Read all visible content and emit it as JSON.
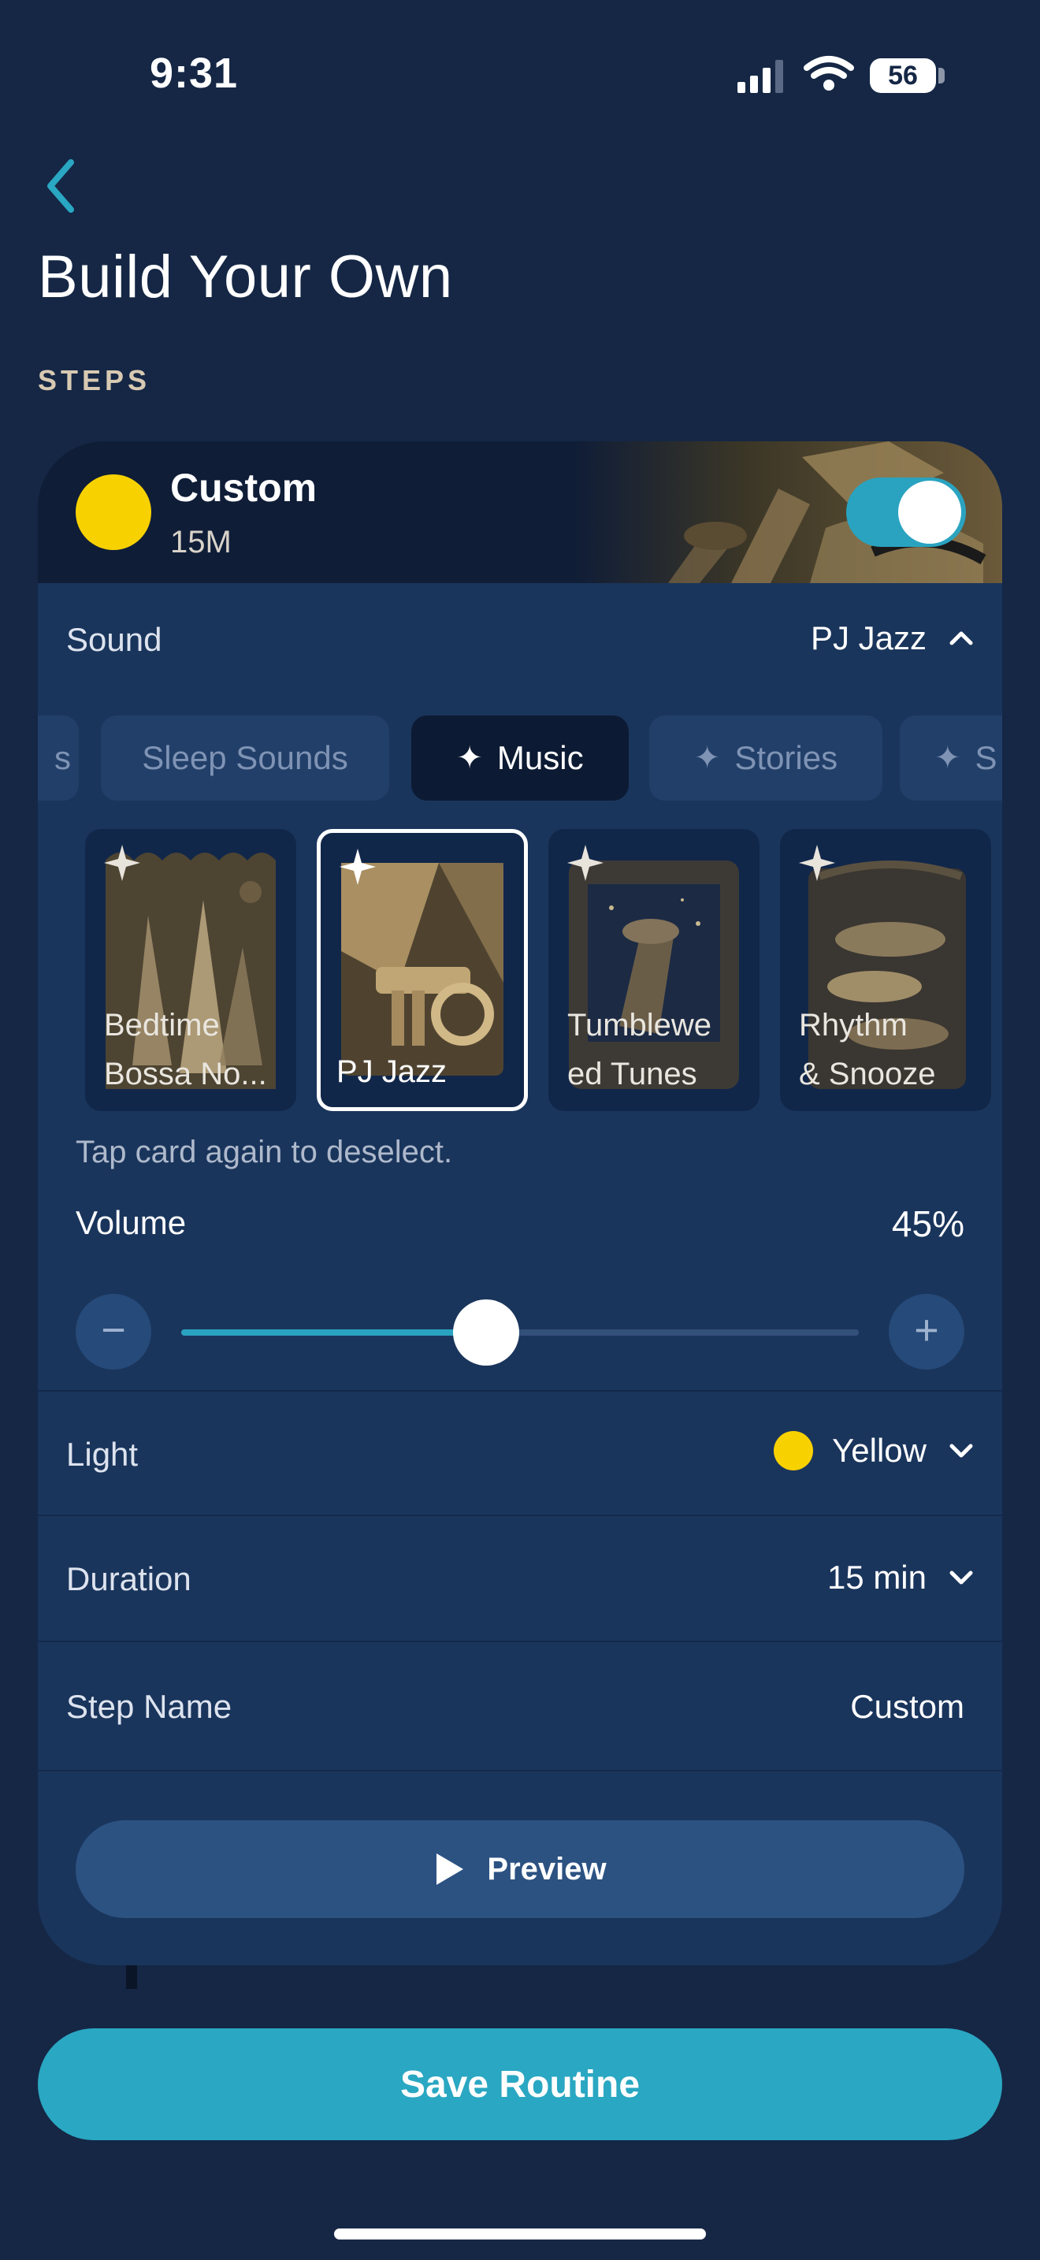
{
  "status_bar": {
    "time": "9:31",
    "battery": "56"
  },
  "page": {
    "title": "Build Your Own",
    "section_label": "STEPS"
  },
  "step_card": {
    "name": "Custom",
    "duration_short": "15M",
    "enabled": true,
    "sound": {
      "label": "Sound",
      "value": "PJ Jazz",
      "categories": [
        {
          "label": "s",
          "active": false
        },
        {
          "label": "Sleep Sounds",
          "active": false
        },
        {
          "label": "Music",
          "active": true
        },
        {
          "label": "Stories",
          "active": false
        },
        {
          "label": "S",
          "active": false
        }
      ],
      "tracks": [
        {
          "title": "Bedtime Bossa No...",
          "line1": "Bedtime",
          "line2": "Bossa No...",
          "selected": false
        },
        {
          "title": "PJ Jazz",
          "line1": "PJ Jazz",
          "line2": "",
          "selected": true
        },
        {
          "title": "Tumbleweed Tunes",
          "line1": "Tumblewe",
          "line2": "ed Tunes",
          "selected": false
        },
        {
          "title": "Rhythm & Snooze",
          "line1": "Rhythm",
          "line2": "& Snooze",
          "selected": false
        }
      ],
      "hint": "Tap card again to deselect."
    },
    "volume": {
      "label": "Volume",
      "value_text": "45%",
      "fraction": 0.45,
      "minus": "−",
      "plus": "+"
    },
    "light": {
      "label": "Light",
      "value": "Yellow",
      "color": "#f8d100"
    },
    "duration": {
      "label": "Duration",
      "value": "15 min"
    },
    "step_name": {
      "label": "Step Name",
      "value": "Custom"
    },
    "preview_label": "Preview"
  },
  "save_label": "Save Routine",
  "colors": {
    "accent": "#2aa7c2",
    "background": "#152745",
    "card": "#1a355c",
    "sun": "#f8d100"
  }
}
